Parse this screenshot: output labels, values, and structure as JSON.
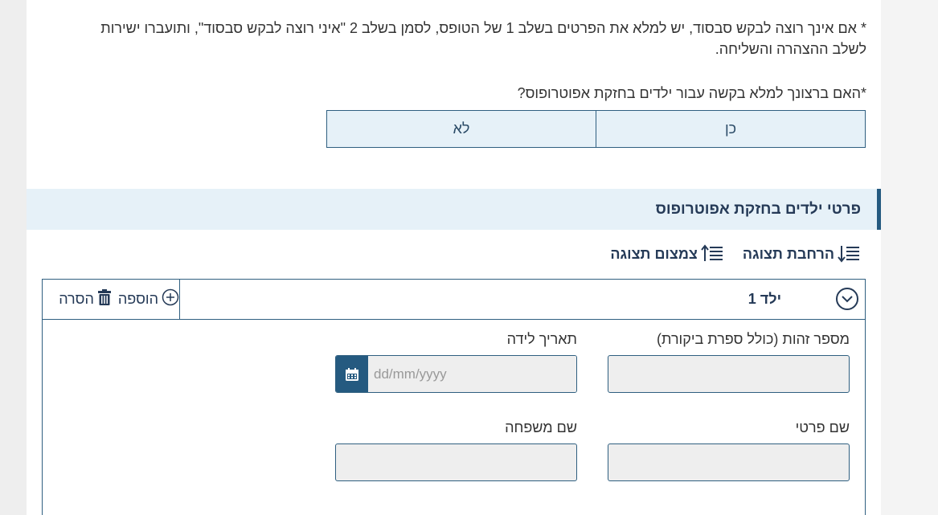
{
  "note": "* אם אינך רוצה לבקש סבסוד, יש למלא את הפרטים בשלב 1 של הטופס, לסמן בשלב 2 \"איני רוצה לבקש סבסוד\", ותועברו ישירות לשלב ההצהרה והשליחה.",
  "question": {
    "required_mark": "*",
    "text": "האם ברצונך למלא בקשה עבור ילדים בחזקת אפוטרופוס?"
  },
  "options": {
    "yes": "כן",
    "no": "לא"
  },
  "section": {
    "title": "פרטי ילדים בחזקת אפוטרופוס"
  },
  "view_controls": {
    "expand": "הרחבת תצוגה",
    "collapse": "צמצום תצוגה"
  },
  "child": {
    "title": "ילד 1",
    "add_label": "הוספה",
    "remove_label": "הסרה",
    "fields": {
      "id_label": "מספר זהות (כולל ספרת ביקורת)",
      "birth_label": "תאריך לידה",
      "birth_placeholder": "dd/mm/yyyy",
      "first_name_label": "שם פרטי",
      "last_name_label": "שם משפחה"
    }
  }
}
